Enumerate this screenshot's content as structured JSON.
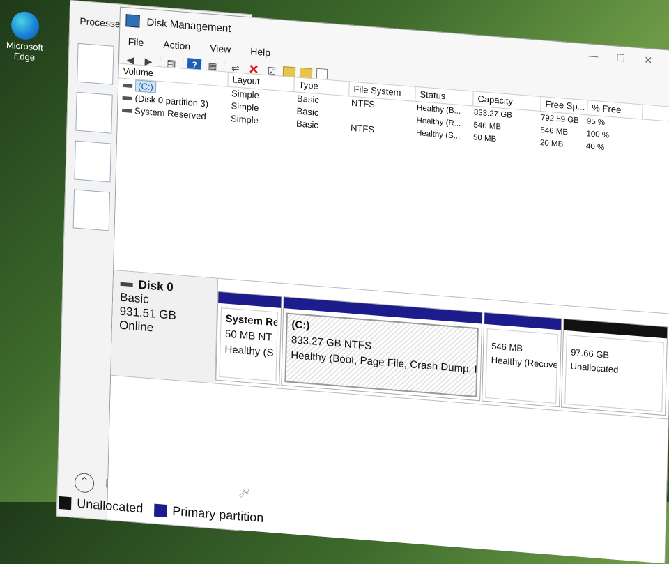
{
  "desktop": {
    "edge_label": "Microsoft Edge"
  },
  "task_manager": {
    "header": "Processe",
    "footer": "Fe"
  },
  "window": {
    "title": "Disk Management",
    "menu": [
      "File",
      "Action",
      "View",
      "Help"
    ]
  },
  "volume_list": {
    "columns": [
      "Volume",
      "Layout",
      "Type",
      "File System",
      "Status",
      "Capacity",
      "Free Sp...",
      "% Free"
    ],
    "rows": [
      {
        "volume": "(C:)",
        "layout": "Simple",
        "type": "Basic",
        "fs": "NTFS",
        "status": "Healthy (B...",
        "capacity": "833.27 GB",
        "free": "792.59 GB",
        "pct": "95 %"
      },
      {
        "volume": "(Disk 0 partition 3)",
        "layout": "Simple",
        "type": "Basic",
        "fs": "",
        "status": "Healthy (R...",
        "capacity": "546 MB",
        "free": "546 MB",
        "pct": "100 %"
      },
      {
        "volume": "System Reserved",
        "layout": "Simple",
        "type": "Basic",
        "fs": "NTFS",
        "status": "Healthy (S...",
        "capacity": "50 MB",
        "free": "20 MB",
        "pct": "40 %"
      }
    ]
  },
  "disk": {
    "name": "Disk 0",
    "type": "Basic",
    "size": "931.51 GB",
    "state": "Online",
    "partitions": [
      {
        "title": "System Re",
        "size": "50 MB NT",
        "status": "Healthy (S"
      },
      {
        "title": "(C:)",
        "size": "833.27 GB NTFS",
        "status": "Healthy (Boot, Page File, Crash Dump, Prim"
      },
      {
        "title": "",
        "size": "546 MB",
        "status": "Healthy (Recovery"
      },
      {
        "title": "",
        "size": "97.66 GB",
        "status": "Unallocated"
      }
    ]
  },
  "legend": {
    "unallocated": "Unallocated",
    "primary": "Primary partition"
  },
  "colors": {
    "primary": "#1c1c8c",
    "unallocated": "#111111",
    "selection": "#cde4f7"
  }
}
